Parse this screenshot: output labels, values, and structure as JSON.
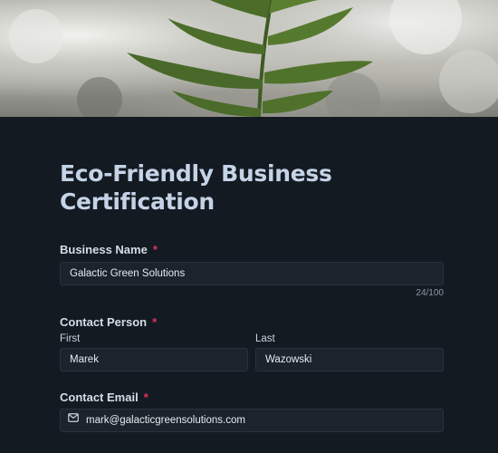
{
  "form": {
    "title": "Eco-Friendly Business Certification",
    "required_marker": "*",
    "business_name": {
      "label": "Business Name",
      "value": "Galactic Green Solutions",
      "counter": "24/100"
    },
    "contact_person": {
      "label": "Contact Person",
      "first_label": "First",
      "first_value": "Marek",
      "last_label": "Last",
      "last_value": "Wazowski"
    },
    "contact_email": {
      "label": "Contact Email",
      "value": "mark@galacticgreensolutions.com",
      "icon": "envelope-icon"
    }
  },
  "colors": {
    "background": "#141a22",
    "title": "#c4d3e6",
    "required": "#e1325a",
    "field_bg": "#1b232c"
  }
}
